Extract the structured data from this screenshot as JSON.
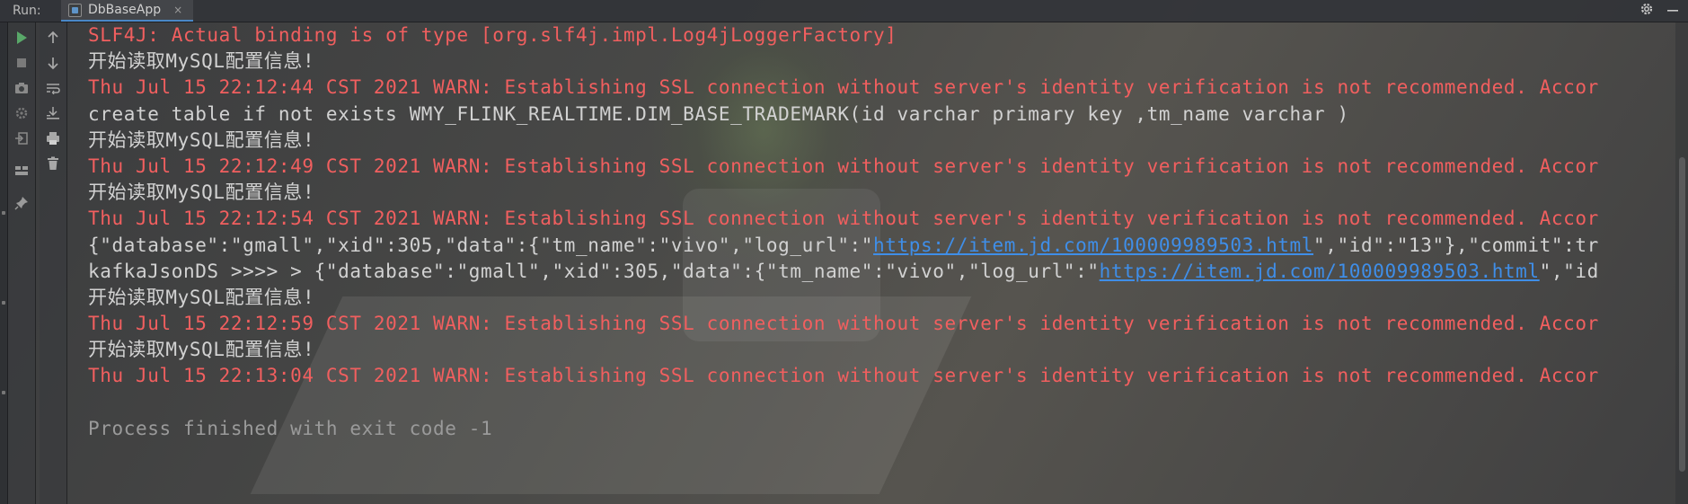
{
  "titlebar": {
    "run_label": "Run:",
    "tab_label": "DbBaseApp",
    "tab_close": "×"
  },
  "toolbar": {
    "col1": [
      "run-icon",
      "stop-icon",
      "camera-icon",
      "debug-gear-icon",
      "exit-icon",
      "layout-icon",
      "pin-icon"
    ],
    "col2": [
      "arrow-up-icon",
      "arrow-down-icon",
      "soft-wrap-icon",
      "scroll-to-end-icon",
      "print-icon",
      "trash-icon"
    ]
  },
  "console": {
    "lines": [
      {
        "type": "warn",
        "text": "SLF4J: Actual binding is of type [org.slf4j.impl.Log4jLoggerFactory]"
      },
      {
        "type": "info",
        "text": "开始读取MySQL配置信息!"
      },
      {
        "type": "warn",
        "text": "Thu Jul 15 22:12:44 CST 2021 WARN: Establishing SSL connection without server's identity verification is not recommended. Accor"
      },
      {
        "type": "info",
        "text": "create table if not exists WMY_FLINK_REALTIME.DIM_BASE_TRADEMARK(id varchar primary key ,tm_name varchar )"
      },
      {
        "type": "info",
        "text": "开始读取MySQL配置信息!"
      },
      {
        "type": "warn",
        "text": "Thu Jul 15 22:12:49 CST 2021 WARN: Establishing SSL connection without server's identity verification is not recommended. Accor"
      },
      {
        "type": "info",
        "text": "开始读取MySQL配置信息!"
      },
      {
        "type": "warn",
        "text": "Thu Jul 15 22:12:54 CST 2021 WARN: Establishing SSL connection without server's identity verification is not recommended. Accor"
      },
      {
        "type": "link",
        "before": "{\"database\":\"gmall\",\"xid\":305,\"data\":{\"tm_name\":\"vivo\",\"log_url\":\"",
        "link": "https://item.jd.com/100009989503.html",
        "after": "\",\"id\":\"13\"},\"commit\":tr"
      },
      {
        "type": "link",
        "before": "kafkaJsonDS >>>> > {\"database\":\"gmall\",\"xid\":305,\"data\":{\"tm_name\":\"vivo\",\"log_url\":\"",
        "link": "https://item.jd.com/100009989503.html",
        "after": "\",\"id"
      },
      {
        "type": "info",
        "text": "开始读取MySQL配置信息!"
      },
      {
        "type": "warn",
        "text": "Thu Jul 15 22:12:59 CST 2021 WARN: Establishing SSL connection without server's identity verification is not recommended. Accor"
      },
      {
        "type": "info",
        "text": "开始读取MySQL配置信息!"
      },
      {
        "type": "warn",
        "text": "Thu Jul 15 22:13:04 CST 2021 WARN: Establishing SSL connection without server's identity verification is not recommended. Accor"
      },
      {
        "type": "blank",
        "text": ""
      },
      {
        "type": "dim",
        "text": "Process finished with exit code -1"
      }
    ]
  },
  "colors": {
    "warn": "#f15f5f",
    "info": "#d4d4d4",
    "link": "#3f8ee8",
    "run_green": "#59a869",
    "tab_underline": "#4a88c7"
  }
}
